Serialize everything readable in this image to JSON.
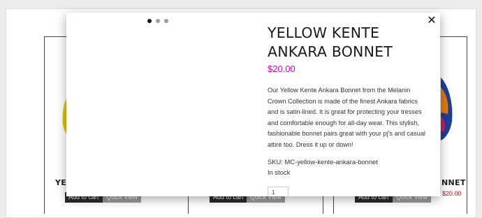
{
  "products": [
    {
      "title": "YEL",
      "add_to_cart": "Add to cart",
      "quick_view": "Quick View"
    },
    {
      "title": "",
      "add_to_cart": "Add to cart",
      "quick_view": "Quick View"
    },
    {
      "title": "NNET",
      "price": "$20.00",
      "add_to_cart": "Add to cart",
      "quick_view": "Quick View"
    }
  ],
  "quick_view": {
    "title": "YELLOW KENTE ANKARA BONNET",
    "price": "$20.00",
    "description": "Our Yellow Kente Ankara Bonnet from the Melanin Crown Collection is made of the finest Ankara fabrics and is satin-lined. It is great for protecting your tresses and comfortable enough for all-day wear.  This stylish, fashionable bonnet pairs great with your pj's and casual attire too. Dress it up or down!",
    "sku": "SKU: MC-yellow-kente-ankara-bonnet",
    "stock": "In stock",
    "quantity": "1",
    "close_icon": "close-icon",
    "slider_dots": 3,
    "active_dot": 0
  },
  "colors": {
    "price_magenta": "#cc00cc",
    "price_red": "#d40000"
  }
}
